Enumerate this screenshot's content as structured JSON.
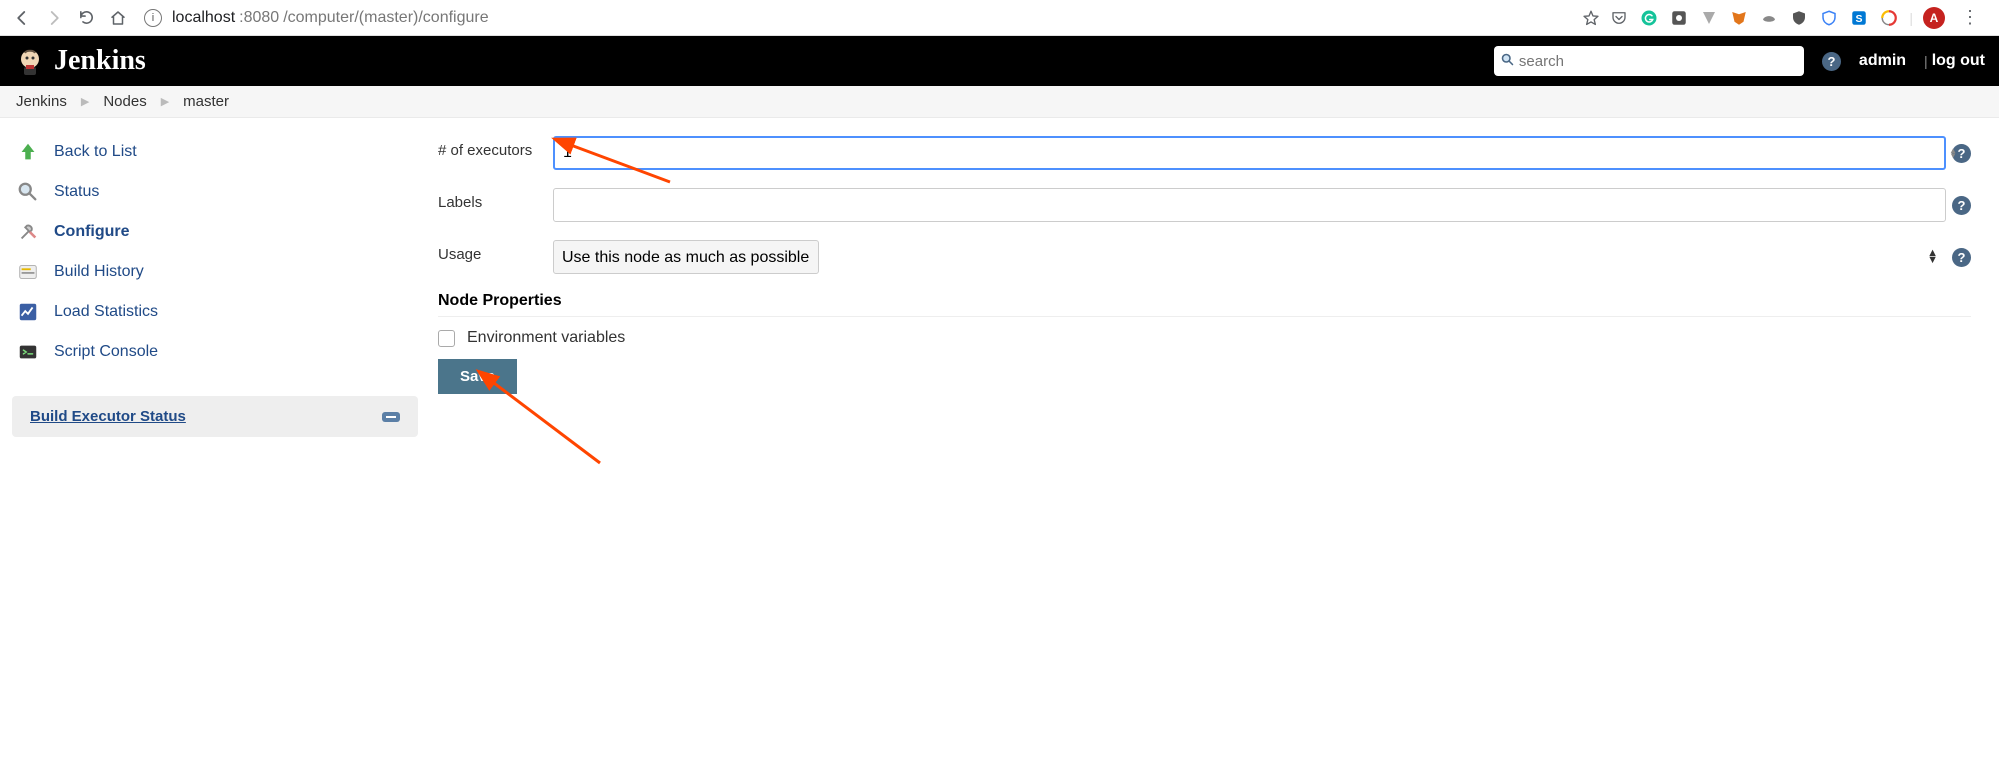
{
  "browser": {
    "url_host": "localhost",
    "url_port": ":8080",
    "url_path": "/computer/(master)/configure",
    "avatar_letter": "A"
  },
  "header": {
    "app_name": "Jenkins",
    "search_placeholder": "search",
    "user_link": "admin",
    "logout_link": "log out"
  },
  "breadcrumbs": {
    "items": [
      "Jenkins",
      "Nodes",
      "master"
    ]
  },
  "sidebar": {
    "items": [
      {
        "label": "Back to List",
        "icon": "arrow-up"
      },
      {
        "label": "Status",
        "icon": "search"
      },
      {
        "label": "Configure",
        "icon": "tools",
        "active": true
      },
      {
        "label": "Build History",
        "icon": "history"
      },
      {
        "label": "Load Statistics",
        "icon": "stats"
      },
      {
        "label": "Script Console",
        "icon": "terminal"
      }
    ],
    "executor_status_label": "Build Executor Status"
  },
  "form": {
    "executors_label": "# of executors",
    "executors_value": "1",
    "labels_label": "Labels",
    "labels_value": "",
    "usage_label": "Usage",
    "usage_value": "Use this node as much as possible",
    "node_properties_title": "Node Properties",
    "env_vars_label": "Environment variables",
    "save_label": "Save"
  }
}
